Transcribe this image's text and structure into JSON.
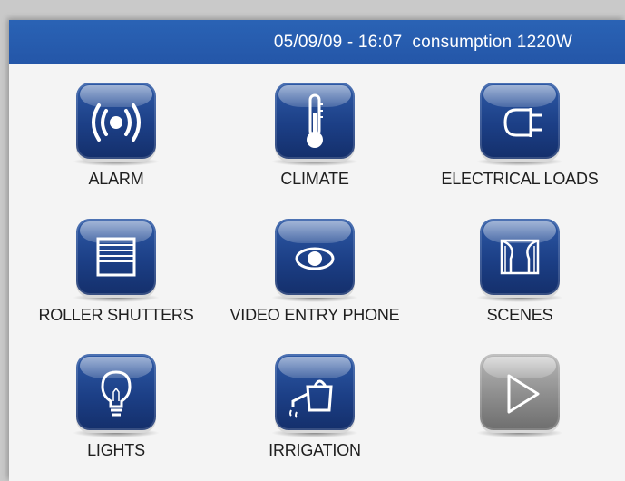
{
  "header": {
    "datetime": "05/09/09 - 16:07",
    "consumption": "consumption 1220W"
  },
  "colors": {
    "accent": "#2456a8",
    "button": "#1c3f86",
    "disabled": "#8d8d8d"
  },
  "tiles": [
    {
      "label": "ALARM",
      "icon": "alarm-icon"
    },
    {
      "label": "CLIMATE",
      "icon": "thermometer-icon"
    },
    {
      "label": "ELECTRICAL LOADS",
      "icon": "plug-icon"
    },
    {
      "label": "ROLLER SHUTTERS",
      "icon": "roller-shutter-icon"
    },
    {
      "label": "VIDEO ENTRY PHONE",
      "icon": "eye-icon"
    },
    {
      "label": "SCENES",
      "icon": "theater-curtain-icon"
    },
    {
      "label": "LIGHTS",
      "icon": "lightbulb-icon"
    },
    {
      "label": "IRRIGATION",
      "icon": "watering-can-icon"
    },
    {
      "label": "",
      "icon": "play-icon"
    }
  ]
}
